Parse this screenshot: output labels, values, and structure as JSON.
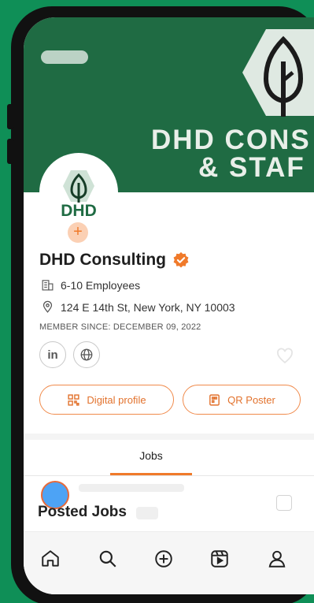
{
  "company": {
    "logo_text": "DHD",
    "name": "DHD Consulting",
    "employees": "6-10 Employees",
    "address": "124 E 14th St, New York, NY 10003",
    "member_since": "MEMBER SINCE: DECEMBER 09, 2022"
  },
  "cover": {
    "title_line1": "DHD CONS",
    "title_line2": "& STAF"
  },
  "social": {
    "linkedin_label": "in"
  },
  "actions": {
    "digital_profile_label": "Digital profile",
    "qr_poster_label": "QR Poster"
  },
  "tabs": {
    "jobs_label": "Jobs"
  },
  "posted_jobs": {
    "title": "Posted Jobs"
  },
  "colors": {
    "background": "#0f8f57",
    "cover": "#1f6b43",
    "accent": "#f07a2a"
  },
  "nav": [
    "home-icon",
    "search-icon",
    "add-icon",
    "reels-icon",
    "profile-icon"
  ]
}
